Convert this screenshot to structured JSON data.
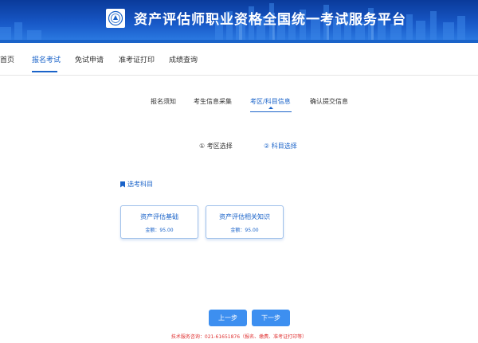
{
  "header": {
    "title": "资产评估师职业资格全国统一考试服务平台",
    "logo_icon": "association-seal-icon"
  },
  "nav": {
    "items": [
      {
        "label": "首页"
      },
      {
        "label": "报名考试"
      },
      {
        "label": "免试申请"
      },
      {
        "label": "准考证打印"
      },
      {
        "label": "成绩查询"
      }
    ],
    "active": "报名考试"
  },
  "steps": {
    "items": [
      {
        "label": "报名须知"
      },
      {
        "label": "考生信息采集"
      },
      {
        "label": "考区/科目信息"
      },
      {
        "label": "确认提交信息"
      }
    ],
    "active": "考区/科目信息"
  },
  "substeps": {
    "region": "① 考区选择",
    "subject": "② 科目选择"
  },
  "section": {
    "label": "选考科目"
  },
  "subjects": [
    {
      "name": "资产评估基础",
      "fee": "金额：95.00"
    },
    {
      "name": "资产评估相关知识",
      "fee": "金额：95.00"
    }
  ],
  "buttons": {
    "prev": "上一步",
    "next": "下一步"
  },
  "footer": {
    "text": "技术服务咨询：021-61651876（报名、缴费、准考证打印等）"
  },
  "colors": {
    "accent": "#1a63c9",
    "button": "#3d8ff0",
    "footer": "#e03434"
  }
}
